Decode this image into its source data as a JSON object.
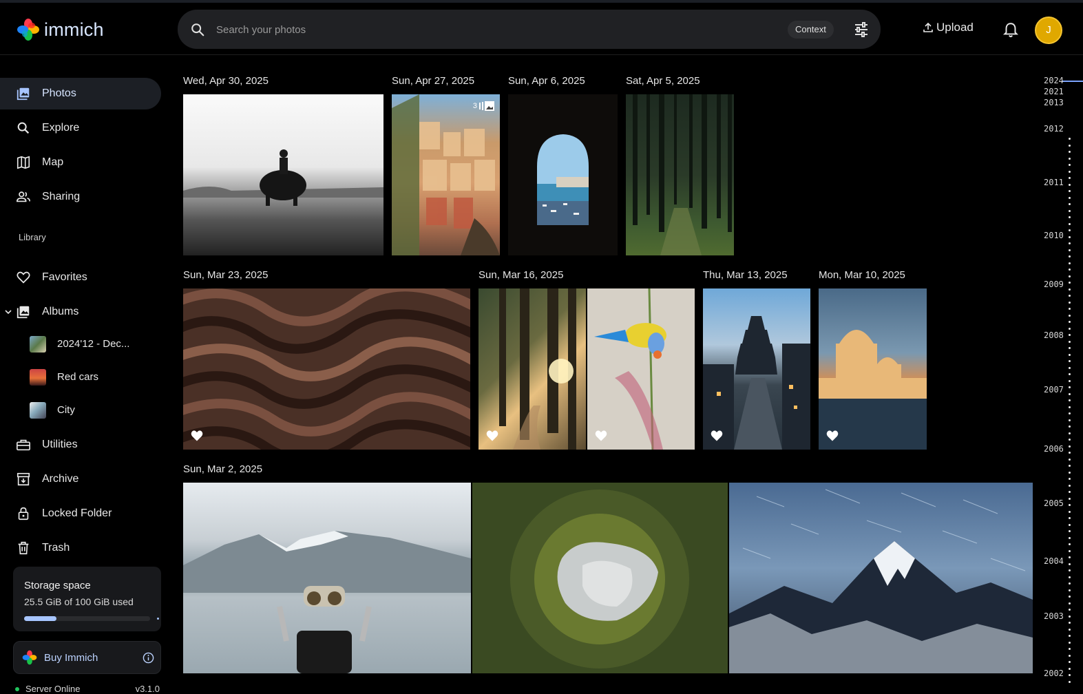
{
  "header": {
    "app_name": "immich",
    "search_placeholder": "Search your photos",
    "context_label": "Context",
    "upload_label": "Upload",
    "avatar_initial": "J"
  },
  "sidebar": {
    "nav": [
      {
        "label": "Photos",
        "icon": "photos-icon",
        "active": true
      },
      {
        "label": "Explore",
        "icon": "search-icon"
      },
      {
        "label": "Map",
        "icon": "map-icon"
      },
      {
        "label": "Sharing",
        "icon": "people-icon"
      }
    ],
    "library_label": "Library",
    "library": [
      {
        "label": "Favorites",
        "icon": "heart-icon"
      },
      {
        "label": "Albums",
        "icon": "album-icon"
      }
    ],
    "albums": [
      {
        "label": "2024'12 - Dec..."
      },
      {
        "label": "Red cars"
      },
      {
        "label": "City"
      }
    ],
    "more": [
      {
        "label": "Utilities",
        "icon": "toolbox-icon"
      },
      {
        "label": "Archive",
        "icon": "archive-icon"
      },
      {
        "label": "Locked Folder",
        "icon": "lock-icon"
      },
      {
        "label": "Trash",
        "icon": "trash-icon"
      }
    ],
    "storage": {
      "title": "Storage space",
      "usage": "25.5 GiB of 100 GiB used",
      "used_fraction": 0.255
    },
    "buy_label": "Buy Immich",
    "server_status": "Server Online",
    "version": "v3.1.0"
  },
  "timeline": {
    "groups": [
      {
        "date": "Wed, Apr 30, 2025"
      },
      {
        "date": "Sun, Apr 27, 2025",
        "stack_count": "3"
      },
      {
        "date": "Sun, Apr 6, 2025"
      },
      {
        "date": "Sat, Apr 5, 2025"
      },
      {
        "date": "Sun, Mar 23, 2025"
      },
      {
        "date": "Sun, Mar 16, 2025"
      },
      {
        "date": "Thu, Mar 13, 2025"
      },
      {
        "date": "Mon, Mar 10, 2025"
      },
      {
        "date": "Sun, Mar 2, 2025"
      }
    ]
  },
  "scrubber": {
    "years": [
      "2024",
      "2021",
      "2013",
      "2012",
      "2011",
      "2010",
      "2009",
      "2008",
      "2007",
      "2006",
      "2005",
      "2004",
      "2003",
      "2002"
    ]
  },
  "colors": {
    "accent": "#a7c5ff",
    "sidebar_active": "#1c1f25",
    "avatar": "#e0a800",
    "online": "#21c55d"
  }
}
